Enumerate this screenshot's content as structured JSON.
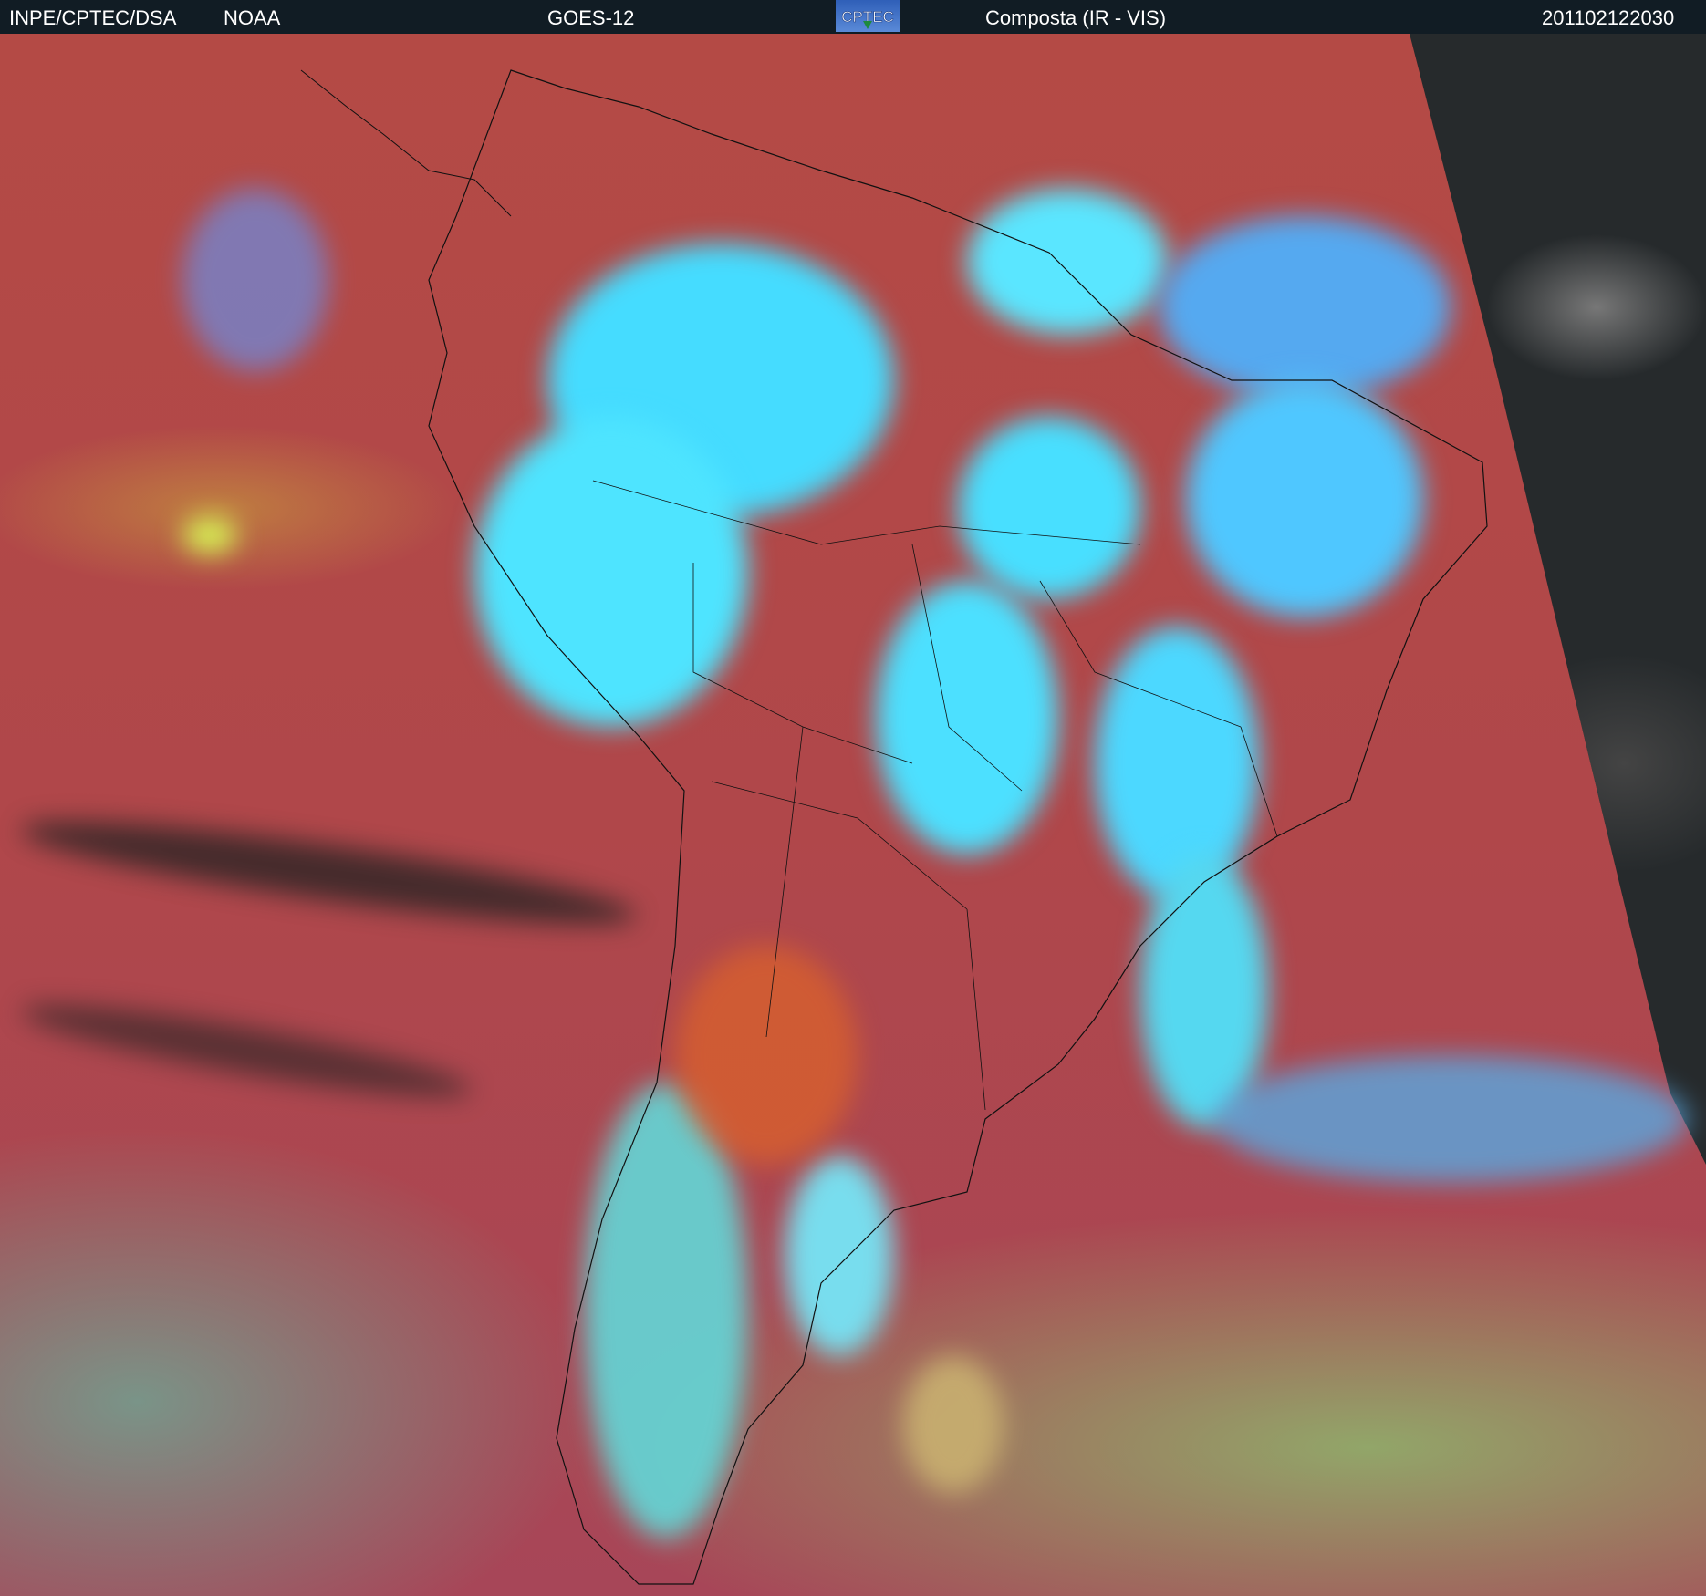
{
  "header": {
    "agency": "INPE/CPTEC/DSA",
    "partner": "NOAA",
    "satellite": "GOES-12",
    "logo_text": "CPTEC",
    "product": "Composta (IR - VIS)",
    "timestamp": "201102122030"
  },
  "colors": {
    "header_bg": "#111c24",
    "ocean_clear": "#b44a45",
    "high_cloud": "#3fe6ff",
    "low_cloud": "#9ee07a",
    "space_view": "#262a2c"
  }
}
